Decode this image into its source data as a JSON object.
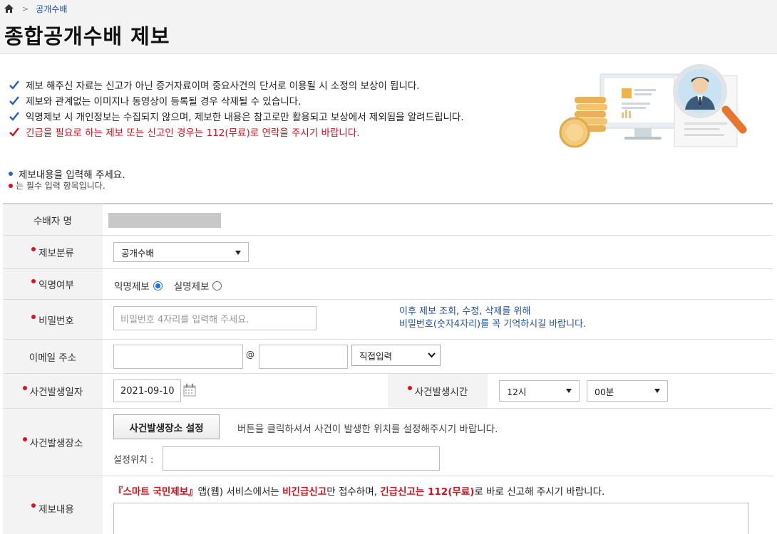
{
  "breadcrumb": {
    "home_icon": "home-icon",
    "current": "공개수배"
  },
  "page_title": "종합공개수배 제보",
  "notices": [
    {
      "text": "제보 해주신 자료는 신고가 아닌 증거자료이며 중요사건의 단서로 이용될 시 소정의 보상이 됩니다.",
      "color": "#222222"
    },
    {
      "text": "제보와 관계없는 이미지나 동영상이 등록될 경우 삭제될 수 있습니다.",
      "color": "#222222"
    },
    {
      "text": "익명제보 시 개인정보는 수집되지 않으며, 제보한 내용은 참고로만 활용되고 보상에서 제외됨을 알려드립니다.",
      "color": "#222222"
    },
    {
      "text": "긴급을 필요로 하는 제보 또는 신고인 경우는 112(무료)로 연락을 주시기 바랍니다.",
      "color": "#d0101b"
    }
  ],
  "guide": {
    "line1": "제보내용을 입력해 주세요.",
    "line2": "는 필수 입력 항목입니다."
  },
  "form": {
    "suspect_label": "수배자 명",
    "category_label": "제보분류",
    "category_value": "공개수배",
    "anon_label": "익명여부",
    "anon_option": "익명제보",
    "real_option": "실명제보",
    "anon_selected": true,
    "password_label": "비밀번호",
    "password_placeholder": "비밀번호 4자리를 입력해 주세요.",
    "password_help1": "이후 제보 조회, 수정, 삭제를 위해",
    "password_help2": "비밀번호(숫자4자리)를 꼭 기억하시길 바랍니다.",
    "email_label": "이메일 주소",
    "email_at": "@",
    "email_domain_select": "직접입력",
    "date_label": "사건발생일자",
    "date_value": "2021-09-10",
    "time_label": "사건발생시간",
    "hour_value": "12시",
    "minute_value": "00분",
    "place_label": "사건발생장소",
    "place_button": "사건발생장소 설정",
    "place_help": "버튼을 클릭하셔서 사건이 발생한 위치를 설정해주시기 바랍니다.",
    "place_set_label": "설정위치 :",
    "content_label": "제보내용",
    "content_notice_a": "『스마트 국민제보』",
    "content_notice_b": "앱(웹) 서비스에서는 ",
    "content_notice_c": "비긴급신고",
    "content_notice_d": "만 접수하며, ",
    "content_notice_e": "긴급신고는 112(무료)",
    "content_notice_f": "로 바로 신고해 주시기 바랍니다."
  }
}
